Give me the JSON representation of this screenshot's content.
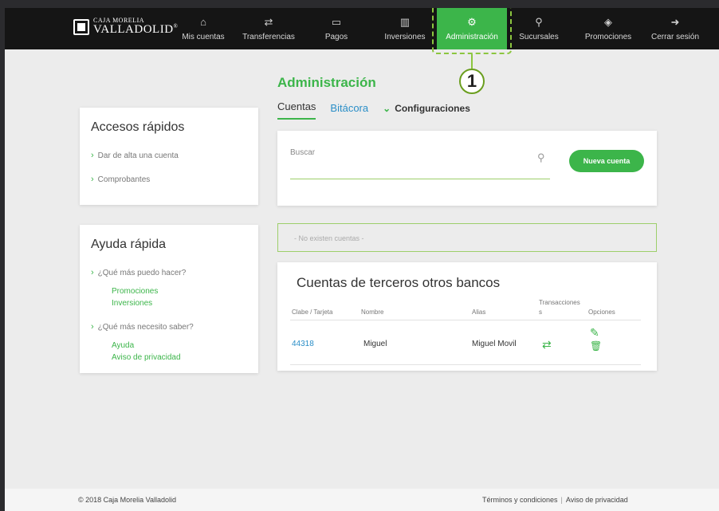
{
  "brand": {
    "line1": "CAJA MORELIA",
    "line2": "VALLADOLID",
    "mark": "®"
  },
  "nav": [
    {
      "label": "Mis cuentas",
      "icon": "⌂"
    },
    {
      "label": "Transferencias",
      "icon": "⇄"
    },
    {
      "label": "Pagos",
      "icon": "▭"
    },
    {
      "label": "Inversiones",
      "icon": "▥"
    },
    {
      "label": "Administración",
      "icon": "⚙"
    },
    {
      "label": "Sucursales",
      "icon": "⚲"
    },
    {
      "label": "Promociones",
      "icon": "◈"
    },
    {
      "label": "Cerrar sesión",
      "icon": "➜"
    }
  ],
  "callout": "1",
  "page": {
    "title": "Administración",
    "tabs": {
      "cuentas": "Cuentas",
      "bitacora": "Bitácora",
      "config": "Configuraciones"
    }
  },
  "accesos": {
    "title": "Accesos rápidos",
    "links": [
      "Dar de alta una cuenta",
      "Comprobantes"
    ]
  },
  "ayuda": {
    "title": "Ayuda rápida",
    "q1": "¿Qué más puedo hacer?",
    "q1_links": [
      "Promociones",
      "Inversiones"
    ],
    "q2": "¿Qué más necesito saber?",
    "q2_links": [
      "Ayuda",
      "Aviso de privacidad"
    ]
  },
  "search": {
    "label": "Buscar",
    "button": "Nueva cuenta"
  },
  "empty_notice": "- No existen cuentas -",
  "table": {
    "title": "Cuentas de terceros otros bancos",
    "headers": {
      "clabe": "Clabe / Tarjeta",
      "nombre": "Nombre",
      "alias": "Alias",
      "trans1": "Transacciones",
      "trans2": "s",
      "opciones": "Opciones"
    },
    "rows": [
      {
        "clabe": "44318",
        "nombre": "Miguel",
        "alias": "Miguel Movil"
      }
    ]
  },
  "footer": {
    "copyright": "© 2018 Caja Morelia Valladolid",
    "terms": "Términos y condiciones",
    "privacy": "Aviso de privacidad"
  },
  "colors": {
    "accent": "#3cb54a",
    "link": "#2a8ec7",
    "nav_bg": "#151515"
  }
}
